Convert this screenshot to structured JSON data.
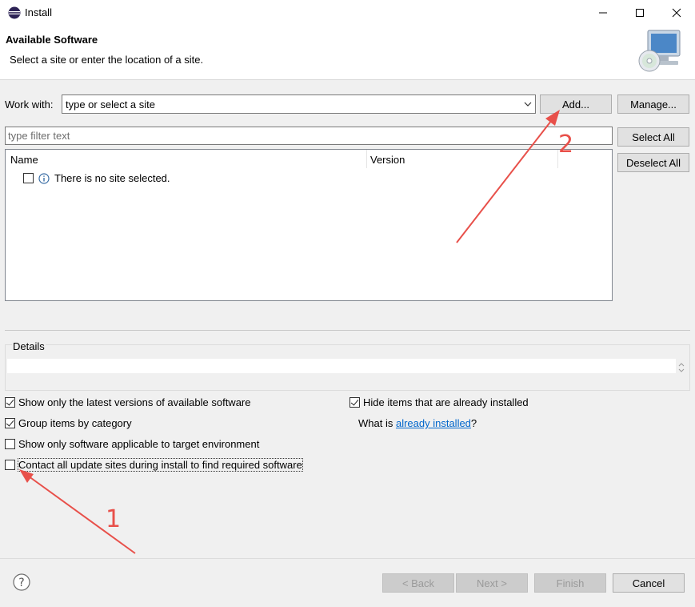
{
  "window": {
    "title": "Install",
    "controls": [
      "minimize-icon",
      "maximize-icon",
      "close-icon"
    ]
  },
  "header": {
    "title": "Available Software",
    "description": "Select a site or enter the location of a site."
  },
  "work_with": {
    "label": "Work with:",
    "value": "type or select a site",
    "add_label": "Add...",
    "manage_label": "Manage..."
  },
  "filter": {
    "placeholder": "type filter text"
  },
  "buttons": {
    "select_all": "Select All",
    "deselect_all": "Deselect All"
  },
  "tree": {
    "columns": [
      "Name",
      "Version"
    ],
    "rows": [
      {
        "text": "There is no site selected.",
        "checked": false,
        "icon": "info-icon"
      }
    ]
  },
  "details": {
    "label": "Details"
  },
  "options": {
    "latest_versions": {
      "label": "Show only the latest versions of available software",
      "checked": true
    },
    "group_category": {
      "label": "Group items by category",
      "checked": true
    },
    "applicable_target": {
      "label": "Show only software applicable to target environment",
      "checked": false
    },
    "contact_sites": {
      "label": "Contact all update sites during install to find required software",
      "checked": false
    },
    "hide_installed": {
      "label": "Hide items that are already installed",
      "checked": true
    },
    "what_is_prefix": "What is ",
    "what_is_link": "already installed",
    "what_is_suffix": "?"
  },
  "footer": {
    "help_icon": "help-icon",
    "back": "< Back",
    "next": "Next >",
    "finish": "Finish",
    "cancel": "Cancel"
  },
  "annotations": {
    "one": "1",
    "two": "2",
    "color": "#e8504a"
  },
  "colors": {
    "link": "#0066cc",
    "annotation": "#e8504a"
  }
}
